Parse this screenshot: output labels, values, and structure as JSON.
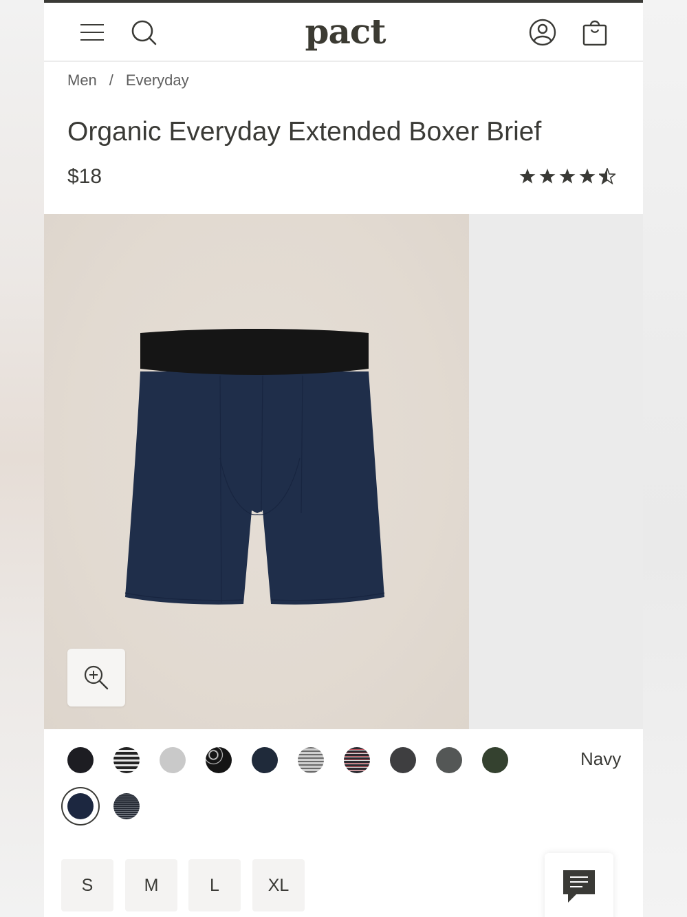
{
  "header": {
    "logo_text": "pact",
    "menu_icon": "hamburger-menu-icon",
    "search_icon": "search-icon",
    "account_icon": "account-user-icon",
    "cart_icon": "shopping-bag-icon"
  },
  "breadcrumb": {
    "items": [
      "Men",
      "Everyday"
    ],
    "separator": "/"
  },
  "product": {
    "title": "Organic Everyday Extended Boxer Brief",
    "price": "$18",
    "rating": 4.5,
    "rating_max": 5
  },
  "media": {
    "zoom_icon": "zoom-in-icon"
  },
  "colors": {
    "selected_name": "Navy",
    "swatches": [
      {
        "id": "black",
        "fill": "#1d1d22"
      },
      {
        "id": "black-stripe",
        "fill": "#2b2b2b"
      },
      {
        "id": "light-gray",
        "fill": "#c8c8c8"
      },
      {
        "id": "black-print",
        "fill": "#151515"
      },
      {
        "id": "dark-navy",
        "fill": "#1f2a3a"
      },
      {
        "id": "gray-stripe",
        "fill": "#9a9a9a"
      },
      {
        "id": "red-stripe",
        "fill": "#4a2c2e"
      },
      {
        "id": "charcoal",
        "fill": "#3e3e40"
      },
      {
        "id": "slate",
        "fill": "#545756"
      },
      {
        "id": "forest-green",
        "fill": "#34412f"
      },
      {
        "id": "navy",
        "fill": "#1c2740"
      },
      {
        "id": "navy-stripe",
        "fill": "#3a3f47"
      }
    ]
  },
  "sizes": {
    "options": [
      "S",
      "M",
      "L",
      "XL"
    ]
  },
  "chat": {
    "icon": "chat-icon"
  },
  "accent_colors": {
    "text": "#3a3a36",
    "image_bg": "#e2dad1",
    "product": "#1f2e4a"
  }
}
